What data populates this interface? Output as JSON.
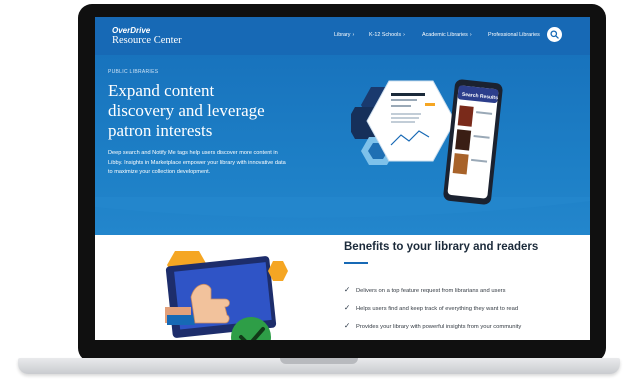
{
  "brand": {
    "name_line1": "OverDrive",
    "name_line2": "Resource Center"
  },
  "nav": {
    "items": [
      {
        "label": "Library",
        "chevron": "›"
      },
      {
        "label": "K-12 Schools",
        "chevron": "›"
      },
      {
        "label": "Academic Libraries",
        "chevron": "›"
      },
      {
        "label": "Professional Libraries",
        "chevron": ""
      }
    ],
    "search_icon": "search-icon"
  },
  "hero": {
    "eyebrow": "PUBLIC LIBRARIES",
    "title_lines": [
      "Expand content",
      "discovery and leverage",
      "patron interests"
    ],
    "description_lines": [
      "Deep search and Notify Me tags help users discover more content in",
      "Libby. Insights in Marketplace empower your library with innovative data",
      "to maximize your collection development."
    ]
  },
  "phone": {
    "header": "Search Results"
  },
  "benefits": {
    "title": "Benefits to your library and readers",
    "items": [
      "Delivers on a top feature request from librarians and users",
      "Helps users find and keep track of everything they want to read",
      "Provides your library with powerful insights from your community"
    ],
    "check_glyph": "✓"
  },
  "colors": {
    "brand_blue": "#1769b5",
    "hero_blue": "#1d7fc6",
    "navy": "#1b2a3a",
    "accent_orange": "#f5a623",
    "accent_green": "#2e9e47"
  }
}
